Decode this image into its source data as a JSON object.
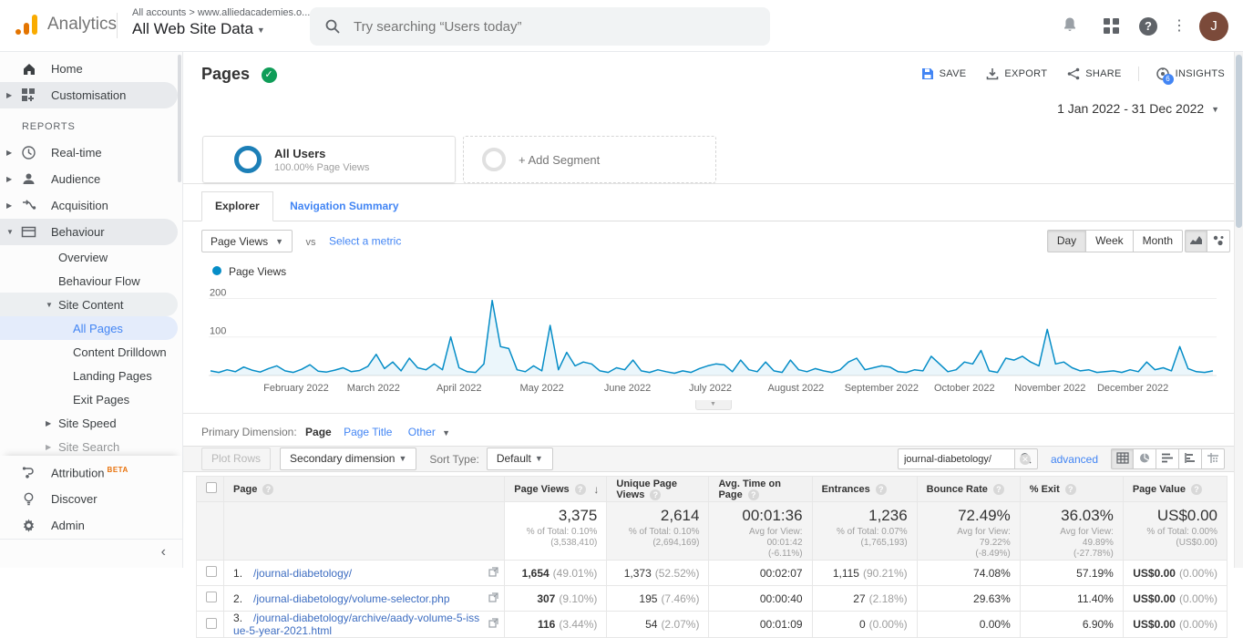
{
  "header": {
    "app_name": "Analytics",
    "breadcrumb": "All accounts > www.alliedacademies.o...",
    "property_name": "All Web Site Data",
    "search_placeholder": "Try searching “Users today”",
    "avatar_initial": "J"
  },
  "sidebar": {
    "home": "Home",
    "customisation": "Customisation",
    "reports_label": "REPORTS",
    "realtime": "Real-time",
    "audience": "Audience",
    "acquisition": "Acquisition",
    "behaviour": "Behaviour",
    "overview": "Overview",
    "behaviour_flow": "Behaviour Flow",
    "site_content": "Site Content",
    "all_pages": "All Pages",
    "content_drilldown": "Content Drilldown",
    "landing_pages": "Landing Pages",
    "exit_pages": "Exit Pages",
    "site_speed": "Site Speed",
    "site_search": "Site Search",
    "attribution": "Attribution",
    "beta": "BETA",
    "discover": "Discover",
    "admin": "Admin"
  },
  "report": {
    "title": "Pages",
    "save": "SAVE",
    "export": "EXPORT",
    "share": "SHARE",
    "insights": "INSIGHTS",
    "insights_badge": "6",
    "date_range": "1 Jan 2022 - 31 Dec 2022",
    "segment_name": "All Users",
    "segment_detail": "100.00% Page Views",
    "add_segment": "+ Add Segment",
    "tab_explorer": "Explorer",
    "tab_navigation": "Navigation Summary",
    "metric_selected": "Page Views",
    "vs_label": "vs",
    "select_metric": "Select a metric",
    "granularity_day": "Day",
    "granularity_week": "Week",
    "granularity_month": "Month",
    "legend_label": "Page Views"
  },
  "chart_data": {
    "type": "line",
    "title": "Page Views",
    "x_start": "1 Jan 2022",
    "x_end": "31 Dec 2022",
    "sample_interval_days": 3,
    "line_color": "#058dc7",
    "ylim": [
      0,
      220
    ],
    "yticks": [
      100,
      200
    ],
    "grid": true,
    "legend_position": "top-left",
    "series": [
      {
        "name": "Page Views",
        "values": [
          12,
          8,
          15,
          10,
          22,
          14,
          9,
          18,
          25,
          12,
          8,
          16,
          28,
          11,
          9,
          14,
          20,
          10,
          13,
          24,
          55,
          18,
          35,
          12,
          45,
          20,
          15,
          30,
          15,
          100,
          20,
          10,
          8,
          30,
          195,
          75,
          70,
          15,
          10,
          25,
          12,
          130,
          15,
          60,
          25,
          35,
          30,
          12,
          8,
          20,
          15,
          40,
          12,
          8,
          15,
          10,
          6,
          12,
          8,
          18,
          25,
          30,
          28,
          10,
          40,
          15,
          10,
          35,
          12,
          8,
          40,
          15,
          10,
          18,
          12,
          8,
          15,
          35,
          45,
          15,
          20,
          25,
          22,
          10,
          8,
          15,
          12,
          50,
          30,
          10,
          15,
          35,
          30,
          65,
          12,
          8,
          45,
          40,
          50,
          35,
          25,
          120,
          30,
          35,
          20,
          12,
          15,
          8,
          10,
          12,
          8,
          15,
          10,
          35,
          15,
          20,
          12,
          75,
          18,
          10,
          8,
          12
        ]
      }
    ],
    "months": [
      {
        "label": "February 2022",
        "day": 31
      },
      {
        "label": "March 2022",
        "day": 59
      },
      {
        "label": "April 2022",
        "day": 90
      },
      {
        "label": "May 2022",
        "day": 120
      },
      {
        "label": "June 2022",
        "day": 151
      },
      {
        "label": "July 2022",
        "day": 181
      },
      {
        "label": "August 2022",
        "day": 212
      },
      {
        "label": "September 2022",
        "day": 243
      },
      {
        "label": "October 2022",
        "day": 273
      },
      {
        "label": "November 2022",
        "day": 304
      },
      {
        "label": "December 2022",
        "day": 334
      }
    ]
  },
  "dimension_bar": {
    "label": "Primary Dimension:",
    "page": "Page",
    "page_title": "Page Title",
    "other": "Other"
  },
  "toolbar": {
    "plot_rows": "Plot Rows",
    "secondary_dimension": "Secondary dimension",
    "sort_type_label": "Sort Type:",
    "sort_type_value": "Default",
    "search_value": "journal-diabetology/",
    "advanced_link": "advanced"
  },
  "table": {
    "columns": {
      "page": "Page",
      "page_views": "Page Views",
      "unique_page_views": "Unique Page Views",
      "avg_time": "Avg. Time on Page",
      "entrances": "Entrances",
      "bounce_rate": "Bounce Rate",
      "exit": "% Exit",
      "page_value": "Page Value"
    },
    "summary": {
      "pv": "3,375",
      "pv_sub1": "% of Total: 0.10%",
      "pv_sub2": "(3,538,410)",
      "upv": "2,614",
      "upv_sub1": "% of Total: 0.10%",
      "upv_sub2": "(2,694,169)",
      "time": "00:01:36",
      "time_sub1": "Avg for View: 00:01:42",
      "time_sub2": "(-6.11%)",
      "entr": "1,236",
      "entr_sub1": "% of Total: 0.07%",
      "entr_sub2": "(1,765,193)",
      "bounce": "72.49%",
      "bounce_sub1": "Avg for View: 79.22%",
      "bounce_sub2": "(-8.49%)",
      "exit": "36.03%",
      "exit_sub1": "Avg for View: 49.89%",
      "exit_sub2": "(-27.78%)",
      "value": "US$0.00",
      "value_sub1": "% of Total: 0.00%",
      "value_sub2": "(US$0.00)"
    },
    "rows": [
      {
        "index": "1.",
        "page": "/journal-diabetology/",
        "pv": "1,654",
        "pv_pct": "(49.01%)",
        "upv": "1,373",
        "upv_pct": "(52.52%)",
        "time": "00:02:07",
        "entr": "1,115",
        "entr_pct": "(90.21%)",
        "bounce": "74.08%",
        "exit": "57.19%",
        "value": "US$0.00",
        "value_pct": "(0.00%)"
      },
      {
        "index": "2.",
        "page": "/journal-diabetology/volume-selector.php",
        "pv": "307",
        "pv_pct": "(9.10%)",
        "upv": "195",
        "upv_pct": "(7.46%)",
        "time": "00:00:40",
        "entr": "27",
        "entr_pct": "(2.18%)",
        "bounce": "29.63%",
        "exit": "11.40%",
        "value": "US$0.00",
        "value_pct": "(0.00%)"
      },
      {
        "index": "3.",
        "page": "/journal-diabetology/archive/aady-volume-5-issue-5-year-2021.html",
        "pv": "116",
        "pv_pct": "(3.44%)",
        "upv": "54",
        "upv_pct": "(2.07%)",
        "time": "00:01:09",
        "entr": "0",
        "entr_pct": "(0.00%)",
        "bounce": "0.00%",
        "exit": "6.90%",
        "value": "US$0.00",
        "value_pct": "(0.00%)"
      }
    ]
  }
}
